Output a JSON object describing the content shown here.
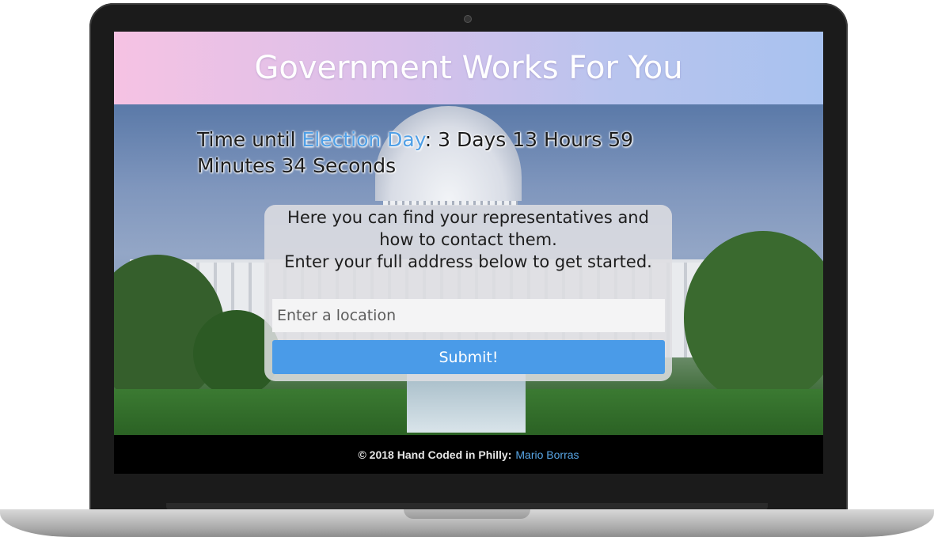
{
  "header": {
    "title": "Government Works For You"
  },
  "countdown": {
    "prefix": "Time until ",
    "link_text": "Election Day",
    "suffix": ": 3 Days 13 Hours 59 Minutes 34 Seconds"
  },
  "card": {
    "line1": "Here you can find your representatives and how to contact them.",
    "line2": "Enter your full address below to get started.",
    "input_placeholder": "Enter a location",
    "submit_label": "Submit!"
  },
  "footer": {
    "credit": "© 2018 Hand Coded in Philly:",
    "author": "Mario Borras"
  },
  "colors": {
    "accent": "#4a9be8",
    "link": "#4f9fe6",
    "header_gradient_start": "#f6c2e3",
    "header_gradient_end": "#a8c2ef"
  }
}
